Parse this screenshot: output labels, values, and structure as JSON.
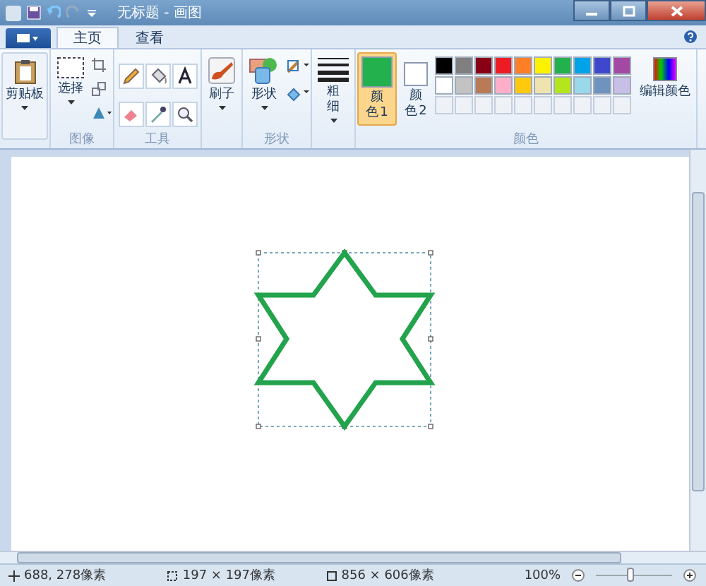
{
  "window": {
    "title": "无标题 - 画图"
  },
  "tabs": [
    {
      "label": "主页",
      "selected": true
    },
    {
      "label": "查看",
      "selected": false
    }
  ],
  "ribbon": {
    "clipboard": "剪贴板",
    "select": "选择",
    "image_group": "图像",
    "tools_group": "工具",
    "brush": "刷子",
    "shapes": "形状",
    "shapes_group": "形状",
    "size": "粗细",
    "colors_group": "颜色",
    "edit_colors": "编辑颜色"
  },
  "color_slots": [
    {
      "label": "颜色 1",
      "color": "#22b14c",
      "selected": true
    },
    {
      "label": "颜色 2",
      "color": "#ffffff",
      "selected": false
    }
  ],
  "palette": [
    {
      "color": "#000000"
    },
    {
      "color": "#7f7f7f"
    },
    {
      "color": "#880015"
    },
    {
      "color": "#ed1c24"
    },
    {
      "color": "#ff7f27"
    },
    {
      "color": "#fff200"
    },
    {
      "color": "#22b14c"
    },
    {
      "color": "#00a2e8"
    },
    {
      "color": "#3f48cc"
    },
    {
      "color": "#a349a4"
    },
    {
      "color": "#ffffff"
    },
    {
      "color": "#c3c3c3"
    },
    {
      "color": "#b97a57"
    },
    {
      "color": "#ffaec9"
    },
    {
      "color": "#ffc90e"
    },
    {
      "color": "#efe4b0"
    },
    {
      "color": "#b5e61d"
    },
    {
      "color": "#99d9ea"
    },
    {
      "color": "#7092be"
    },
    {
      "color": "#c8bfe7"
    }
  ],
  "status": {
    "cursor": "688, 278像素",
    "selection": "197 × 197像素",
    "size": "856 × 606像素",
    "zoom": "100%",
    "zoom_slider": {
      "level": 0.45
    }
  }
}
